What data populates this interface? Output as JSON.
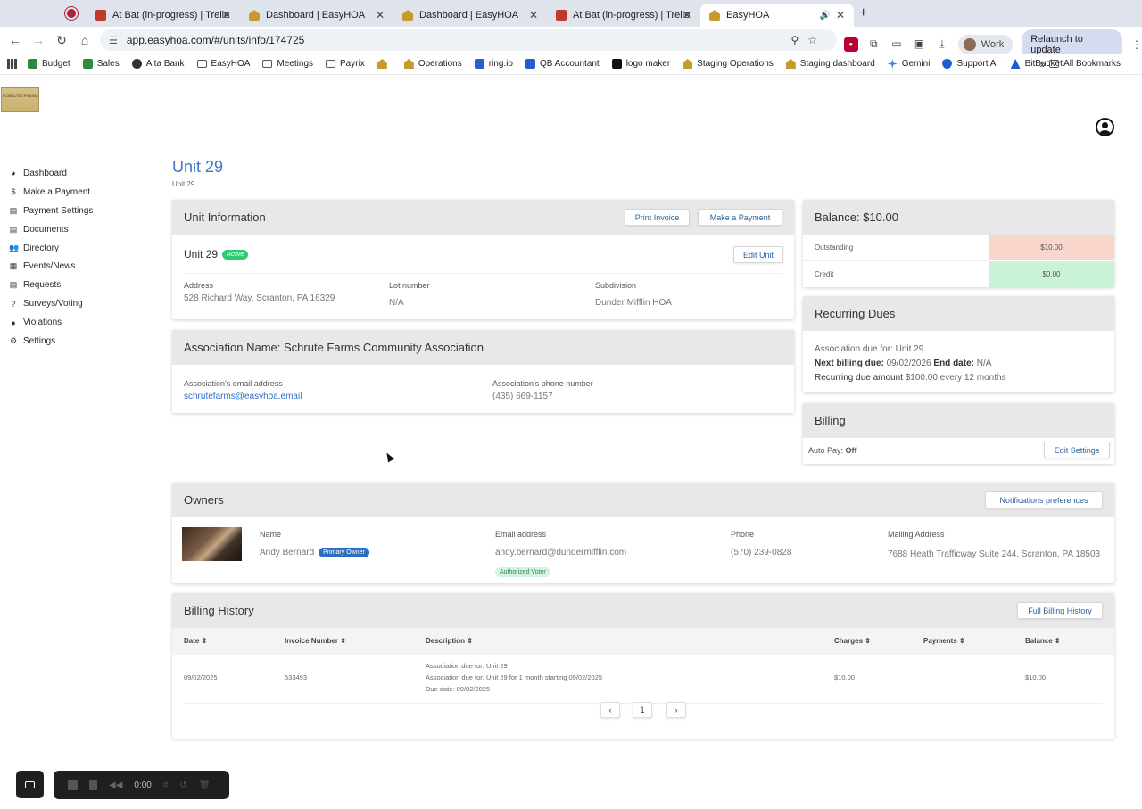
{
  "browser": {
    "tabs": [
      {
        "title": "At Bat (in-progress) | Trello",
        "icon": "trello"
      },
      {
        "title": "Dashboard | EasyHOA",
        "icon": "hoa"
      },
      {
        "title": "Dashboard | EasyHOA",
        "icon": "hoa"
      },
      {
        "title": "At Bat (in-progress) | Trello",
        "icon": "trello"
      },
      {
        "title": "EasyHOA",
        "icon": "hoa"
      }
    ],
    "url": "app.easyhoa.com/#/units/info/174725",
    "profile": "Work",
    "relaunch": "Relaunch to update",
    "bookmarks": [
      "Budget",
      "Sales",
      "Alta Bank",
      "EasyHOA",
      "Meetings",
      "Payrix",
      "",
      "Operations",
      "ring.io",
      "QB Accountant",
      "logo maker",
      "Staging Operations",
      "Staging dashboard",
      "Gemini",
      "Support Ai",
      "BitBucket"
    ],
    "all_bookmarks": "All Bookmarks"
  },
  "sidebar": {
    "items": [
      {
        "label": "Dashboard",
        "icon": "dashboard-icon"
      },
      {
        "label": "Make a Payment",
        "icon": "dollar-icon"
      },
      {
        "label": "Payment Settings",
        "icon": "document-icon"
      },
      {
        "label": "Documents",
        "icon": "document-icon"
      },
      {
        "label": "Directory",
        "icon": "people-icon"
      },
      {
        "label": "Events/News",
        "icon": "calendar-icon"
      },
      {
        "label": "Requests",
        "icon": "document-icon"
      },
      {
        "label": "Surveys/Voting",
        "icon": "question-icon"
      },
      {
        "label": "Violations",
        "icon": "alert-icon"
      },
      {
        "label": "Settings",
        "icon": "gear-icon"
      }
    ]
  },
  "page": {
    "title": "Unit 29",
    "subtitle": "Unit 29"
  },
  "unit_info": {
    "header": "Unit Information",
    "print_invoice": "Print Invoice",
    "make_payment": "Make a Payment",
    "unit_name": "Unit 29",
    "status": "Active",
    "edit_unit": "Edit Unit",
    "address_label": "Address",
    "address": "528 Richard Way, Scranton, PA 16329",
    "lot_label": "Lot number",
    "lot": "N/A",
    "subdivision_label": "Subdivision",
    "subdivision": "Dunder Mifflin HOA"
  },
  "association": {
    "header": "Association Name: Schrute Farms Community Association",
    "email_label": "Association's email address",
    "email": "schrutefarms@easyhoa.email",
    "phone_label": "Association's phone number",
    "phone": "(435) 669-1157"
  },
  "balance": {
    "header": "Balance: $10.00",
    "outstanding_label": "Outstanding",
    "outstanding": "$10.00",
    "credit_label": "Credit",
    "credit": "$0.00",
    "outstanding_color": "#f9d6cc",
    "credit_color": "#c9f2d6"
  },
  "recurring": {
    "header": "Recurring Dues",
    "line1": "Association due for: Unit 29",
    "next_label": "Next billing due:",
    "next_value": "09/02/2026",
    "end_label": "End date:",
    "end_value": "N/A",
    "amount_label": "Recurring due amount",
    "amount_value": "$100.00 every 12 months"
  },
  "billing": {
    "header": "Billing",
    "autopay_label": "Auto Pay:",
    "autopay_value": "Off",
    "edit_settings": "Edit Settings"
  },
  "owners": {
    "header": "Owners",
    "notifications": "Notifications preferences",
    "name_label": "Name",
    "name": "Andy Bernard",
    "primary": "Primary Owner",
    "email_label": "Email address",
    "email": "andy.bernard@dundermifflin.com",
    "voter": "Authorized Voter",
    "phone_label": "Phone",
    "phone": "(570) 239-0828",
    "mail_label": "Mailing Address",
    "mail": "7688 Heath Trafficway Suite 244, Scranton, PA 18503"
  },
  "history": {
    "header": "Billing History",
    "full": "Full Billing History",
    "columns": [
      "Date",
      "Invoice Number",
      "Description",
      "Charges",
      "Payments",
      "Balance"
    ],
    "rows": [
      {
        "date": "09/02/2025",
        "invoice": "533493",
        "desc1": "Association due for: Unit 29",
        "desc2": "Association due for: Unit 29 for 1 month starting 09/02/2025",
        "desc3": "Due date: 09/02/2025",
        "charges": "$10.00",
        "payments": "",
        "balance": "$10.00"
      }
    ],
    "page": "1"
  },
  "recorder": {
    "time": "0:00"
  }
}
